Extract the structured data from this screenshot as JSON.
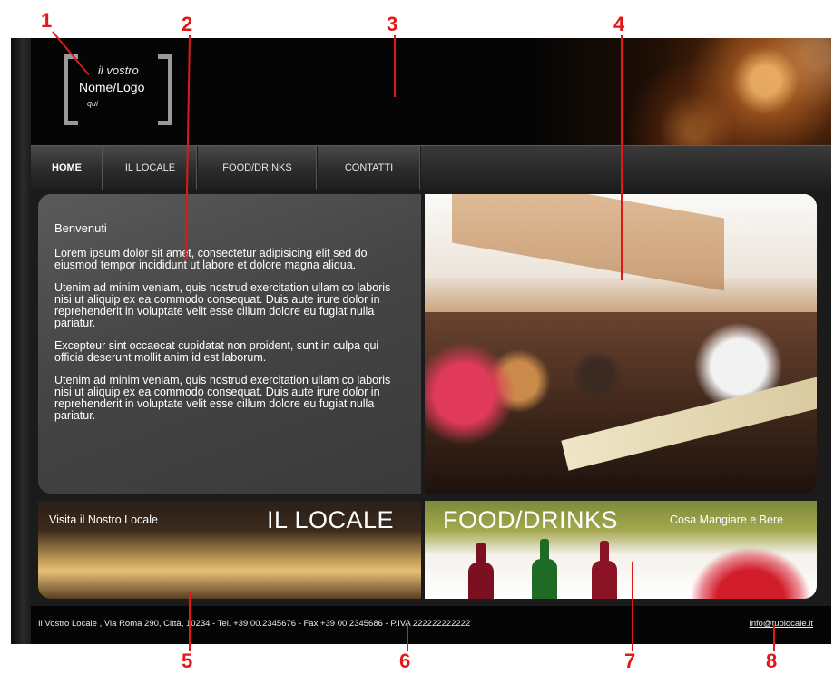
{
  "logo": {
    "line1": "il vostro",
    "line2": "Nome/Logo",
    "line3": "qui"
  },
  "nav": {
    "items": [
      "HOME",
      "IL LOCALE",
      "FOOD/DRINKS",
      "CONTATTI"
    ]
  },
  "content": {
    "welcome": "Benvenuti",
    "paragraphs": [
      "Lorem ipsum dolor sit amet, consectetur adipisicing elit sed do eiusmod tempor incididunt ut labore et dolore magna aliqua.",
      "Utenim ad minim veniam, quis nostrud exercitation ullam co laboris nisi ut aliquip ex ea commodo consequat. Duis aute irure dolor in reprehenderit in voluptate velit esse cillum dolore eu fugiat nulla pariatur.",
      "Excepteur sint occaecat cupidatat non proident, sunt in culpa qui officia deserunt mollit anim id est laborum.",
      "Utenim ad minim veniam, quis nostrud exercitation ullam co laboris nisi ut aliquip ex ea commodo consequat. Duis aute irure dolor in reprehenderit in voluptate velit esse cillum dolore eu fugiat nulla pariatur."
    ]
  },
  "banners": {
    "locale": {
      "small": "Visita il Nostro Locale",
      "big": "IL LOCALE"
    },
    "food": {
      "big": "FOOD/DRINKS",
      "small": "Cosa Mangiare e Bere"
    }
  },
  "footer": {
    "address": "Il Vostro Locale , Via Roma 290, Città, 10234 - Tel. +39 00.2345676 - Fax +39 00.2345686 - P.IVA 222222222222",
    "email": "info@tuolocale.it"
  },
  "callouts": [
    "1",
    "2",
    "3",
    "4",
    "5",
    "6",
    "7",
    "8"
  ],
  "colors": {
    "callout": "#e21818",
    "background": "#1b1b1b"
  }
}
